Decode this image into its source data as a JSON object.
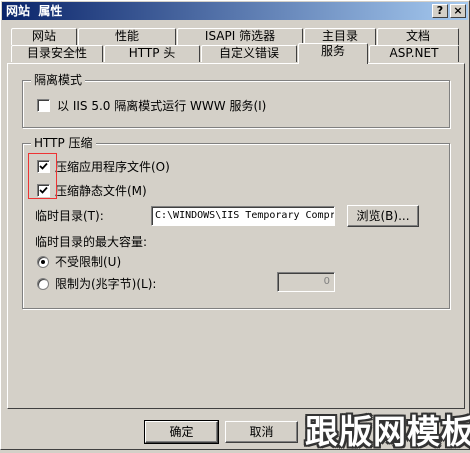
{
  "window": {
    "title": "网站  属性",
    "help_button": "?",
    "close_button": "×"
  },
  "tabs": {
    "back_row": [
      {
        "label": "网站"
      },
      {
        "label": "性能"
      },
      {
        "label": "ISAPI 筛选器"
      },
      {
        "label": "主目录"
      },
      {
        "label": "文档"
      }
    ],
    "front_row": [
      {
        "label": "目录安全性"
      },
      {
        "label": "HTTP 头"
      },
      {
        "label": "自定义错误"
      },
      {
        "label": "服务"
      },
      {
        "label": "ASP.NET"
      }
    ],
    "selected": "服务"
  },
  "isolation": {
    "group_title": "隔离模式",
    "checkbox_label": "以 IIS 5.0 隔离模式运行 WWW 服务(I)",
    "checked": false
  },
  "compression": {
    "group_title": "HTTP 压缩",
    "app_files_label": "压缩应用程序文件(O)",
    "app_files_checked": true,
    "static_files_label": "压缩静态文件(M)",
    "static_files_checked": true,
    "temp_dir_label": "临时目录(T):",
    "temp_dir_value": "C:\\WINDOWS\\IIS Temporary Compr",
    "browse_button": "浏览(B)...",
    "max_size_label": "临时目录的最大容量:",
    "unlimited_label": "不受限制(U)",
    "unlimited_selected": true,
    "limit_label": "限制为(兆字节)(L):",
    "limit_selected": false,
    "limit_value": "0"
  },
  "footer": {
    "ok_button": "确定",
    "cancel_button": "取消"
  },
  "watermark": "跟版网模板",
  "colors": {
    "titlebar_start": "#0a246a",
    "titlebar_end": "#a6caf0",
    "face": "#d4d0c8",
    "annotation_box": "#e33333"
  }
}
